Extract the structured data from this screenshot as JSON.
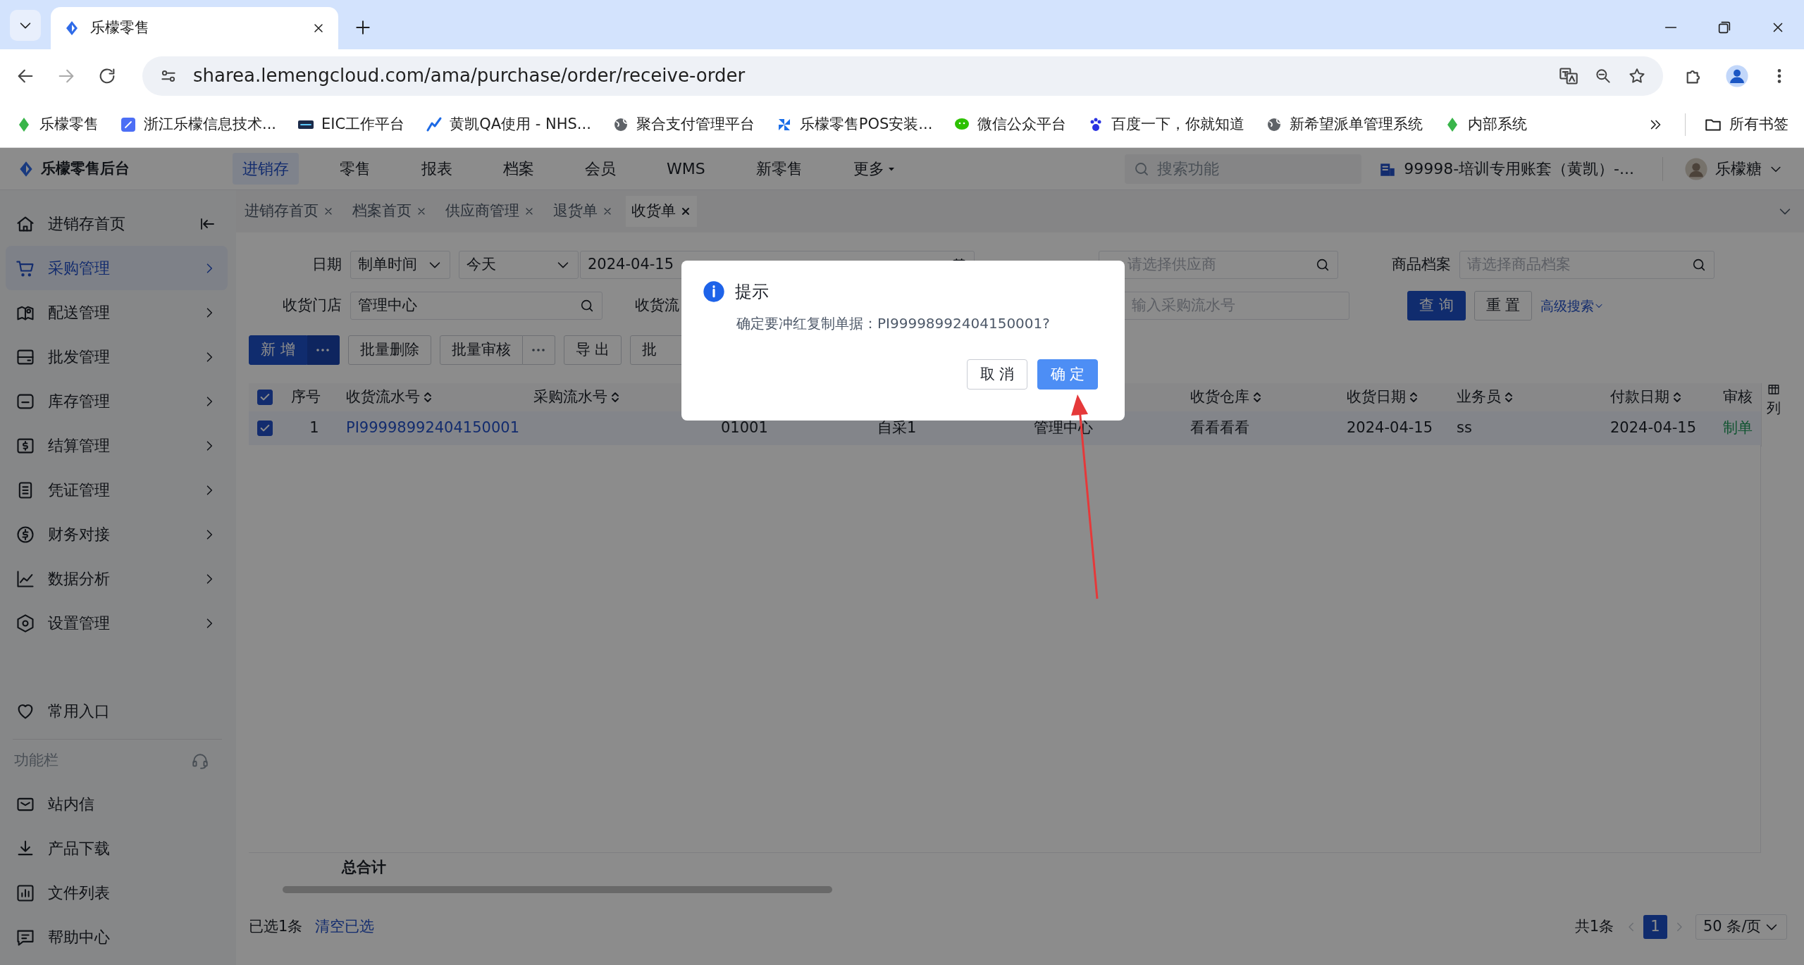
{
  "browser": {
    "tab_title": "乐檬零售",
    "url": "sharea.lemengcloud.com/ama/purchase/order/receive-order",
    "bookmarks": [
      {
        "label": "乐檬零售"
      },
      {
        "label": "浙江乐檬信息技术..."
      },
      {
        "label": "EIC工作平台"
      },
      {
        "label": "黄凯QA使用 - NHS..."
      },
      {
        "label": "聚合支付管理平台"
      },
      {
        "label": "乐檬零售POS安装..."
      },
      {
        "label": "微信公众平台"
      },
      {
        "label": "百度一下，你就知道"
      },
      {
        "label": "新希望派单管理系统"
      },
      {
        "label": "内部系统"
      }
    ],
    "all_bookmarks": "所有书签"
  },
  "app": {
    "logo": "乐檬零售后台",
    "nav": [
      {
        "label": "进销存",
        "selected": true
      },
      {
        "label": "零售",
        "selected": false
      },
      {
        "label": "报表",
        "selected": false
      },
      {
        "label": "档案",
        "selected": false
      },
      {
        "label": "会员",
        "selected": false
      },
      {
        "label": "WMS",
        "selected": false
      },
      {
        "label": "新零售",
        "selected": false
      },
      {
        "label": "更多",
        "selected": false,
        "dropdown": true
      }
    ],
    "search": {
      "placeholder": "搜索功能"
    },
    "account": "99998-培训专用账套（黄凯）-...",
    "user": "乐檬糖"
  },
  "sidebar": {
    "items": [
      {
        "label": "进销存首页",
        "selected": false,
        "arrow": false
      },
      {
        "label": "采购管理",
        "selected": true,
        "arrow": true
      },
      {
        "label": "配送管理",
        "selected": false,
        "arrow": true
      },
      {
        "label": "批发管理",
        "selected": false,
        "arrow": true
      },
      {
        "label": "库存管理",
        "selected": false,
        "arrow": true
      },
      {
        "label": "结算管理",
        "selected": false,
        "arrow": true
      },
      {
        "label": "凭证管理",
        "selected": false,
        "arrow": true
      },
      {
        "label": "财务对接",
        "selected": false,
        "arrow": true
      },
      {
        "label": "数据分析",
        "selected": false,
        "arrow": true
      },
      {
        "label": "设置管理",
        "selected": false,
        "arrow": true
      }
    ],
    "favorites": "常用入口",
    "section": "功能栏",
    "tools": [
      {
        "label": "站内信"
      },
      {
        "label": "产品下载"
      },
      {
        "label": "文件列表"
      },
      {
        "label": "帮助中心"
      }
    ]
  },
  "page_tabs": [
    {
      "label": "进销存首页",
      "selected": false
    },
    {
      "label": "档案首页",
      "selected": false
    },
    {
      "label": "供应商管理",
      "selected": false
    },
    {
      "label": "退货单",
      "selected": false
    },
    {
      "label": "收货单",
      "selected": true
    }
  ],
  "filters": {
    "date_label": "日期",
    "date_type": "制单时间",
    "date_range": "今天",
    "date_from": "2024-04-15",
    "supplier_placeholder": "请选择供应商",
    "goods_label": "商品档案",
    "goods_placeholder": "请选择商品档案",
    "store_label": "收货门店",
    "store_value": "管理中心",
    "serial_label": "收货流",
    "serial_placeholder": "输入采购流水号",
    "query": "查 询",
    "reset": "重 置",
    "advanced": "高级搜索"
  },
  "toolbar": [
    {
      "label": "新 增",
      "kind": "primary_split"
    },
    {
      "label": "批量删除",
      "kind": "plain"
    },
    {
      "label": "批量审核",
      "kind": "split"
    },
    {
      "label": "导 出",
      "kind": "plain"
    },
    {
      "label": "批",
      "kind": "plain"
    }
  ],
  "table": {
    "header_checked": true,
    "columns": [
      {
        "label": "序号",
        "sortable": false,
        "cells": [
          "1"
        ]
      },
      {
        "label": "收货流水号",
        "sortable": true,
        "kind": "link",
        "cells": [
          "PI99998992404150001"
        ]
      },
      {
        "label": "采购流水号",
        "sortable": true
      },
      {
        "cells": [
          "01001"
        ]
      },
      {
        "cells": [
          "自采1"
        ]
      },
      {
        "cells": [
          "管理中心"
        ]
      },
      {
        "label": "收货仓库",
        "sortable": true,
        "cells": [
          "看看看看"
        ]
      },
      {
        "label": "收货日期",
        "sortable": true,
        "cells": [
          "2024-04-15"
        ]
      },
      {
        "label": "业务员",
        "sortable": true,
        "cells": [
          "ss"
        ]
      },
      {
        "label": "付款日期",
        "sortable": true,
        "cells": [
          "2024-04-15"
        ]
      },
      {
        "label": "审核",
        "sortable": false,
        "kind": "status",
        "cells": [
          "制单"
        ]
      }
    ],
    "rows": [
      {
        "checked": true
      }
    ],
    "column_settings": "列",
    "total_label": "总合计"
  },
  "footer": {
    "selected_count": "已选1条",
    "clear": "清空已选",
    "total": "共1条",
    "pages": [
      {
        "label": "1",
        "selected": true
      }
    ],
    "page_size": "50 条/页"
  },
  "dialog": {
    "title": "提示",
    "message": "确定要冲红复制单据：PI99998992404150001?",
    "buttons": [
      {
        "label": "取 消",
        "kind": "default"
      },
      {
        "label": "确 定",
        "kind": "primary"
      }
    ]
  }
}
